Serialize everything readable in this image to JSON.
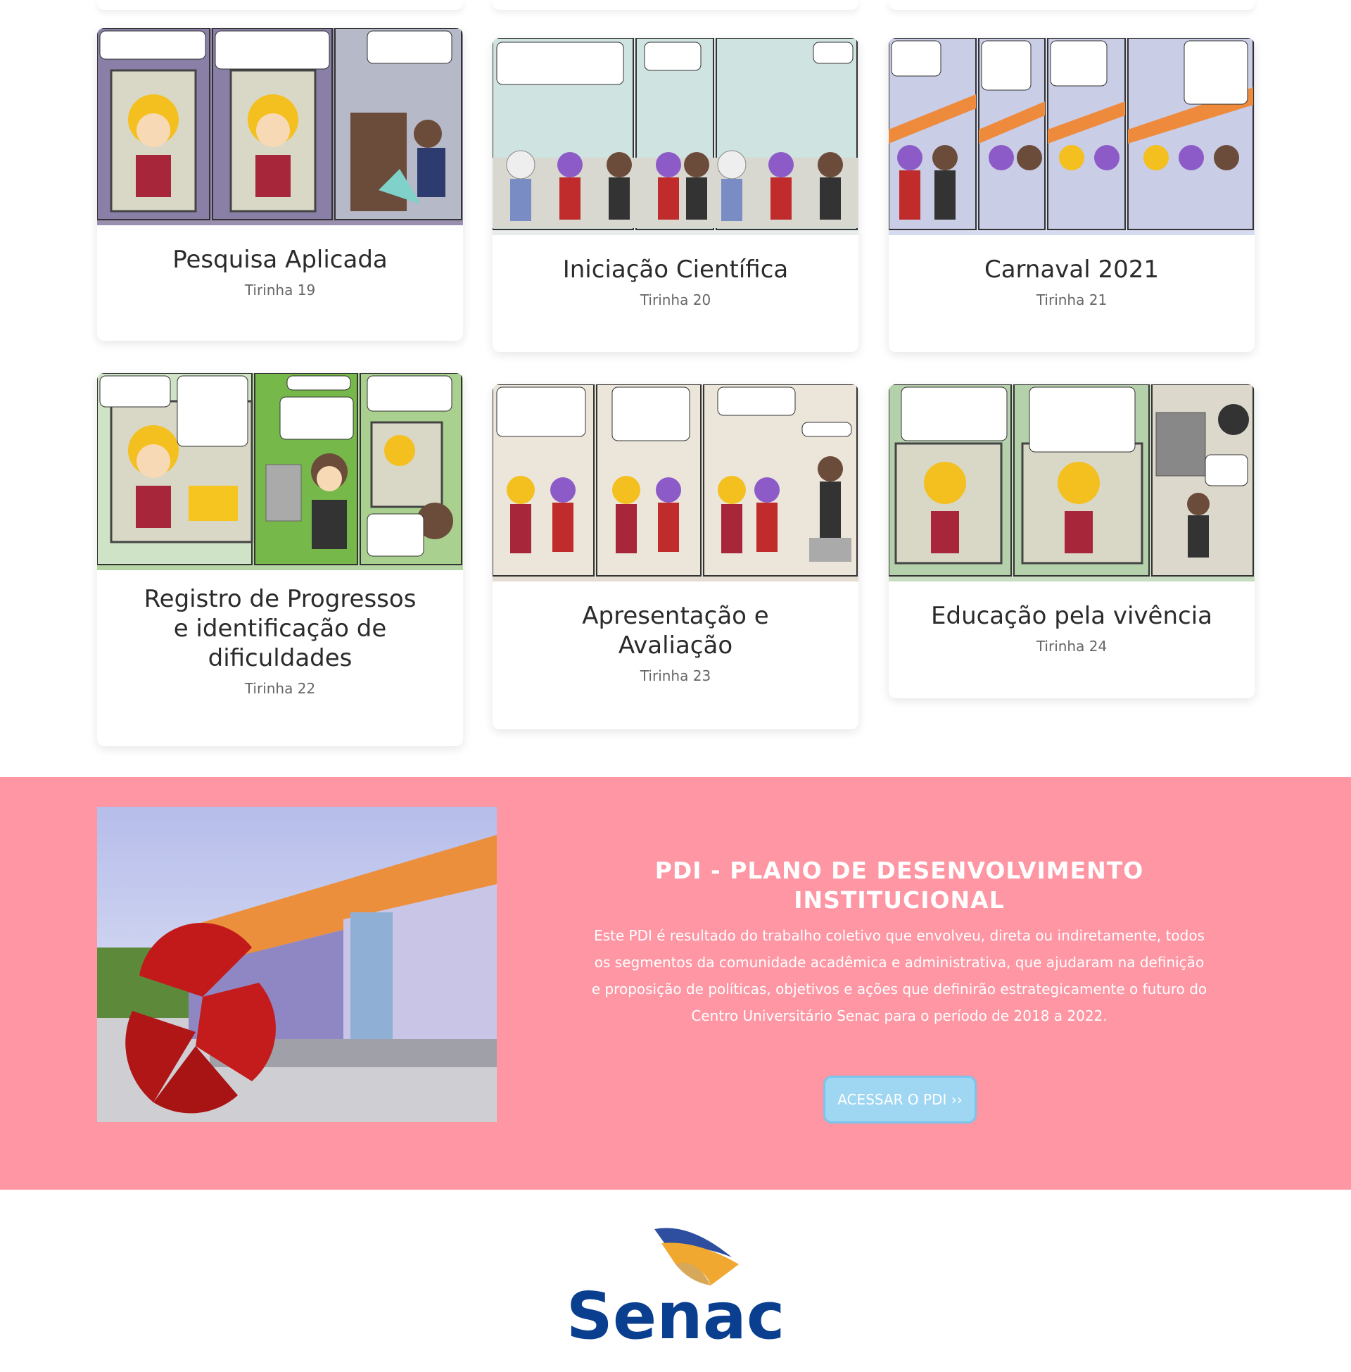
{
  "cards": [
    {
      "title": "Pesquisa Aplicada",
      "subtitle": "Tirinha 19"
    },
    {
      "title": "Iniciação Científica",
      "subtitle": "Tirinha 20"
    },
    {
      "title": "Carnaval 2021",
      "subtitle": "Tirinha 21"
    },
    {
      "title_lines": [
        "Registro de Progressos",
        "e identificação de",
        "dificuldades"
      ],
      "subtitle": "Tirinha 22"
    },
    {
      "title_lines": [
        "Apresentação e",
        "Avaliação"
      ],
      "subtitle": "Tirinha 23"
    },
    {
      "title": "Educação pela vivência",
      "subtitle": "Tirinha 24"
    }
  ],
  "pdi": {
    "title_line1": "PDI - PLANO DE DESENVOLVIMENTO",
    "title_line2": "INSTITUCIONAL",
    "description": "Este PDI é resultado do trabalho coletivo que envolveu, direta ou indiretamente, todos os segmentos da comunidade acadêmica e administrativa, que ajudaram na definição e proposição de políticas, objetivos e ações que definirão estrategicamente o futuro do Centro Universitário Senac para o período de 2018 a 2022.",
    "button_label": "ACESSAR O PDI ››"
  },
  "footer": {
    "logo_text": "Senac"
  },
  "colors": {
    "pdi_background": "#fe96a4",
    "button_background": "#9fd6f2",
    "logo_blue": "#0a3f8f",
    "logo_orange": "#f0a830"
  }
}
